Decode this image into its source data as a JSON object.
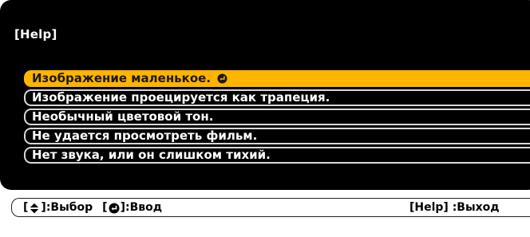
{
  "dialog": {
    "title": "[Help]",
    "items": [
      {
        "label": "Изображение маленькое.",
        "selected": true,
        "icon": "enter-icon"
      },
      {
        "label": "Изображение проецируется как трапеция.",
        "selected": false
      },
      {
        "label": "Необычный цветовой тон.",
        "selected": false
      },
      {
        "label": "Не удается просмотреть фильм.",
        "selected": false
      },
      {
        "label": "Нет звука, или он слишком тихий.",
        "selected": false
      }
    ]
  },
  "status_bar": {
    "select_hint": {
      "open": "[",
      "icon": "up-down-arrow-icon",
      "close": "]",
      "text": ":Выбор"
    },
    "enter_hint": {
      "open": "[",
      "icon": "enter-icon",
      "close": "]",
      "text": ":Ввод"
    },
    "exit_hint": "[Help] :Выход"
  },
  "colors": {
    "panel_background": "#000000",
    "selection_highlight": "#ffb400",
    "item_border": "#d8d8d8",
    "text_light": "#ffffff",
    "text_dark": "#000000"
  }
}
